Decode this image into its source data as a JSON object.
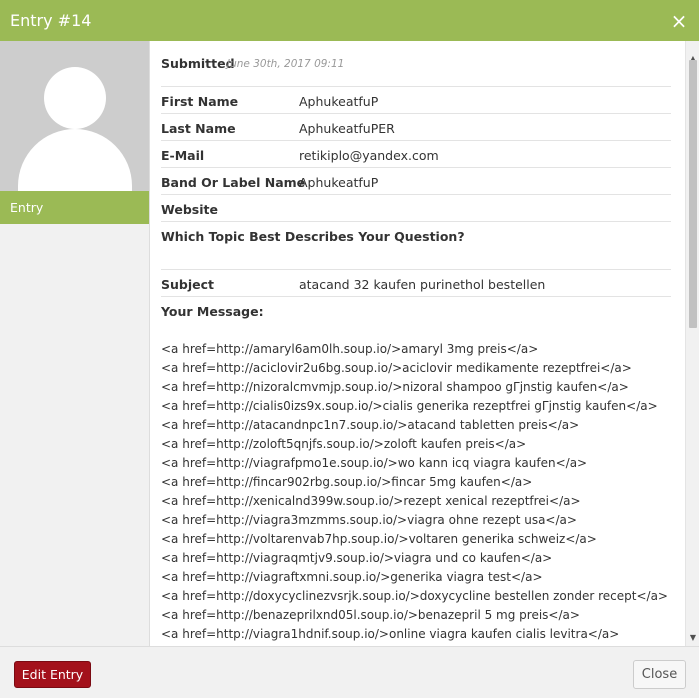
{
  "window": {
    "title": "Entry #14",
    "close_glyph": "×",
    "close_icon": "close-icon"
  },
  "sidebar": {
    "tab_label": "Entry",
    "avatar_icon": "user-avatar-icon"
  },
  "entry": {
    "submitted_label": "Submitted",
    "submitted_date": "June 30th, 2017 09:11",
    "fields": [
      {
        "label": "First Name",
        "value": "AphukeatfuP"
      },
      {
        "label": "Last Name",
        "value": "AphukeatfuPER"
      },
      {
        "label": "E-Mail",
        "value": "retikiplo@yandex.com"
      },
      {
        "label": "Band Or Label Name",
        "value": "AphukeatfuP"
      },
      {
        "label": "Website",
        "value": ""
      },
      {
        "label": "Which Topic Best Describes Your Question?",
        "value": ""
      },
      {
        "label": "Subject",
        "value": "atacand 32 kaufen purinethol bestellen"
      }
    ],
    "message_label": "Your Message:",
    "message_lines": [
      "<a href=http://amaryl6am0lh.soup.io/>amaryl 3mg preis</a>",
      "<a href=http://aciclovir2u6bg.soup.io/>aciclovir medikamente rezeptfrei</a>",
      "<a href=http://nizoralcmvmjp.soup.io/>nizoral shampoo gΓјnstig kaufen</a>",
      "<a href=http://cialis0izs9x.soup.io/>cialis generika rezeptfrei gΓјnstig kaufen</a>",
      "<a href=http://atacandnpc1n7.soup.io/>atacand tabletten preis</a>",
      "<a href=http://zoloft5qnjfs.soup.io/>zoloft kaufen preis</a>",
      "<a href=http://viagrafpmo1e.soup.io/>wo kann icq viagra kaufen</a>",
      "<a href=http://fincar902rbg.soup.io/>fincar 5mg kaufen</a>",
      "<a href=http://xenicalnd399w.soup.io/>rezept xenical rezeptfrei</a>",
      "<a href=http://viagra3mzmms.soup.io/>viagra ohne rezept usa</a>",
      "<a href=http://voltarenvab7hp.soup.io/>voltaren generika schweiz</a>",
      "<a href=http://viagraqmtjv9.soup.io/>viagra und co kaufen</a>",
      "<a href=http://viagraftxmni.soup.io/>generika viagra test</a>",
      "<a href=http://doxycyclinezvsrjk.soup.io/>doxycycline bestellen zonder recept</a>",
      "<a href=http://benazeprilxnd05l.soup.io/>benazepril 5 mg preis</a>",
      "<a href=http://viagra1hdnif.soup.io/>online viagra kaufen cialis levitra</a>"
    ]
  },
  "footer": {
    "edit_label": "Edit Entry",
    "close_label": "Close"
  },
  "scrollbar": {
    "up_glyph": "▲",
    "down_glyph": "▼"
  },
  "colors": {
    "accent": "#9bba55",
    "danger": "#a3111b"
  }
}
